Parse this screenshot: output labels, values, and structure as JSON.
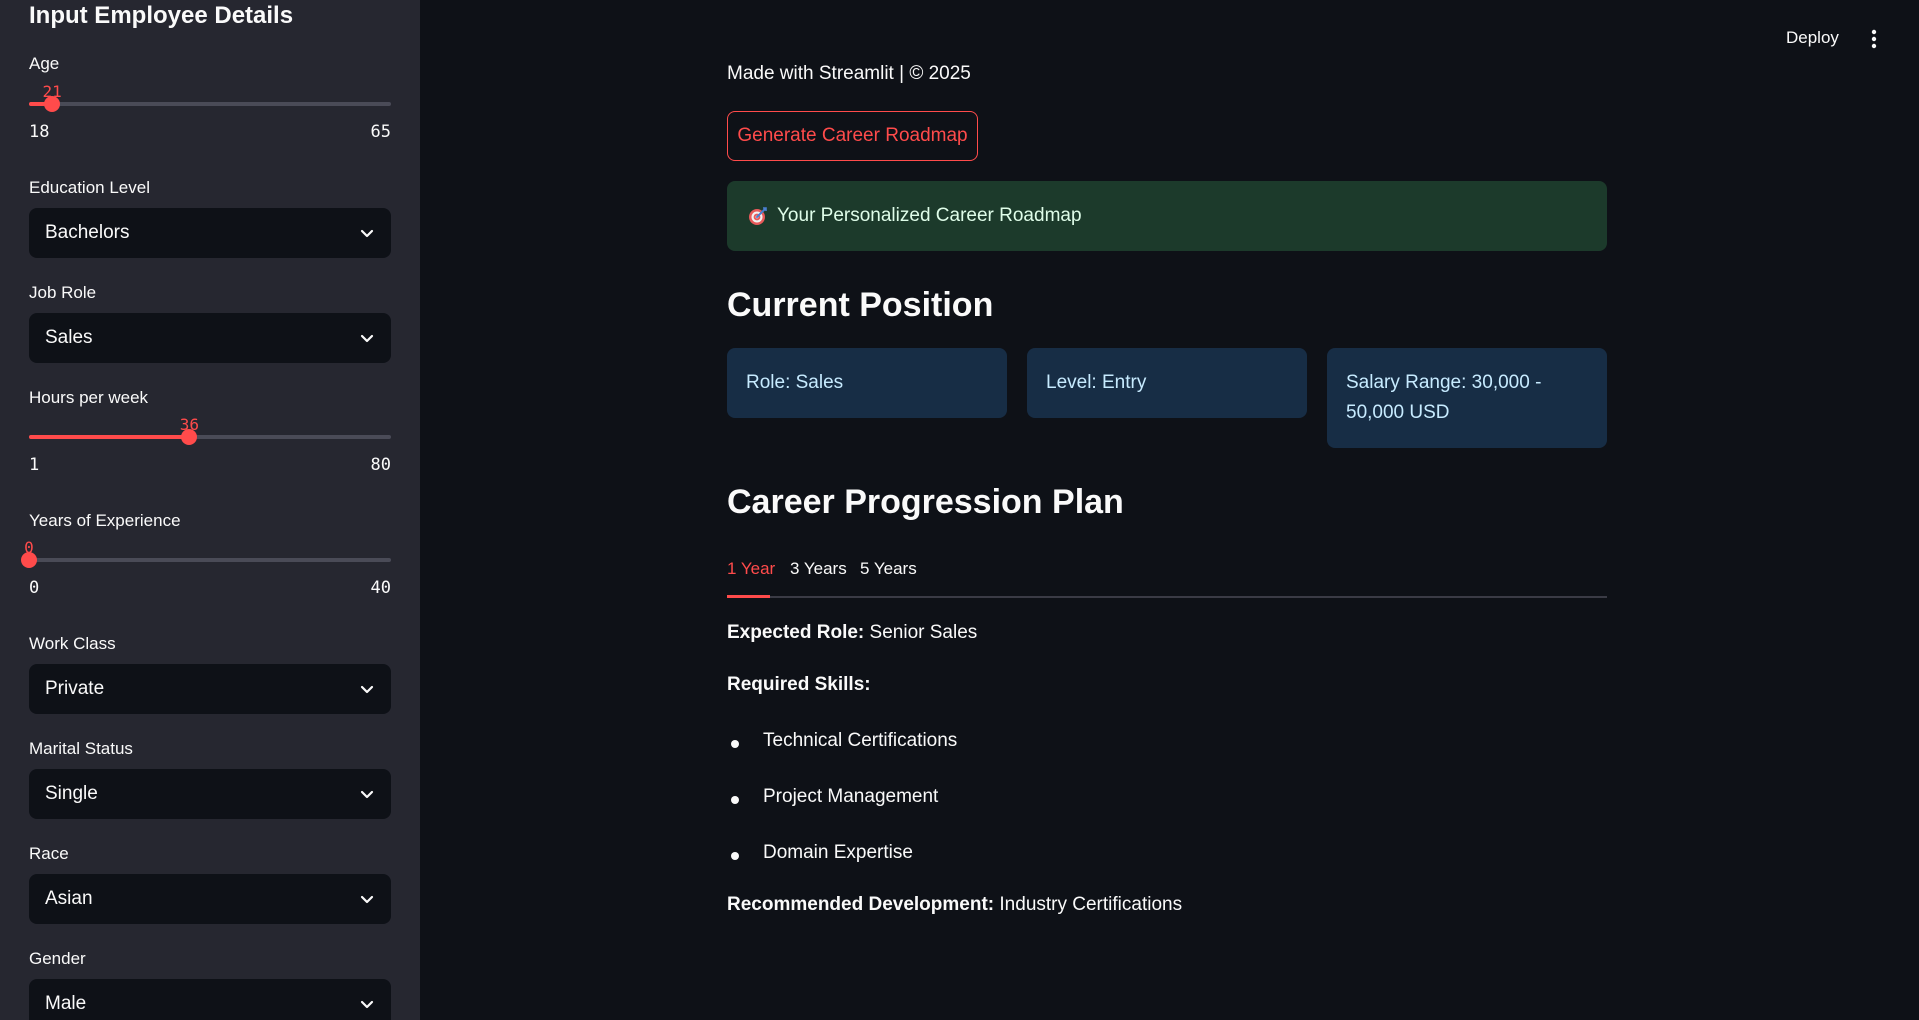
{
  "sidebar": {
    "title": "Input Employee Details",
    "age": {
      "label": "Age",
      "value": 21,
      "value_text": "21",
      "min": "18",
      "max": "65",
      "range": [
        18,
        65
      ]
    },
    "education": {
      "label": "Education Level",
      "value": "Bachelors"
    },
    "job_role": {
      "label": "Job Role",
      "value": "Sales"
    },
    "hours": {
      "label": "Hours per week",
      "value": 36,
      "value_text": "36",
      "min": "1",
      "max": "80",
      "range": [
        1,
        80
      ]
    },
    "experience": {
      "label": "Years of Experience",
      "value": 0,
      "value_text": "0",
      "min": "0",
      "max": "40",
      "range": [
        0,
        40
      ]
    },
    "work_class": {
      "label": "Work Class",
      "value": "Private"
    },
    "marital": {
      "label": "Marital Status",
      "value": "Single"
    },
    "race": {
      "label": "Race",
      "value": "Asian"
    },
    "gender": {
      "label": "Gender",
      "value": "Male"
    }
  },
  "header": {
    "deploy_label": "Deploy",
    "menu_icon": "kebab-menu-icon"
  },
  "main": {
    "made_with": "Made with Streamlit | © 2025",
    "generate_button": "Generate Career Roadmap",
    "success_icon": "target-icon",
    "success_text": "Your Personalized Career Roadmap",
    "current_heading": "Current Position",
    "cards": {
      "role": "Role: Sales",
      "level": "Level: Entry",
      "salary": "Salary Range: 30,000 - 50,000 USD"
    },
    "plan_heading": "Career Progression Plan",
    "tabs": [
      "1 Year",
      "3 Years",
      "5 Years"
    ],
    "expected_role_label": "Expected Role:",
    "expected_role_value": "Senior Sales",
    "required_skills_label": "Required Skills:",
    "skills": [
      "Technical Certifications",
      "Project Management",
      "Domain Expertise"
    ],
    "recommended_label": "Recommended Development:",
    "recommended_value": "Industry Certifications"
  },
  "colors": {
    "accent": "#ff4b4b",
    "sidebar_bg": "#262730",
    "page_bg": "#0e1117",
    "success_bg": "#1c3a2b",
    "info_bg": "#172d45"
  }
}
